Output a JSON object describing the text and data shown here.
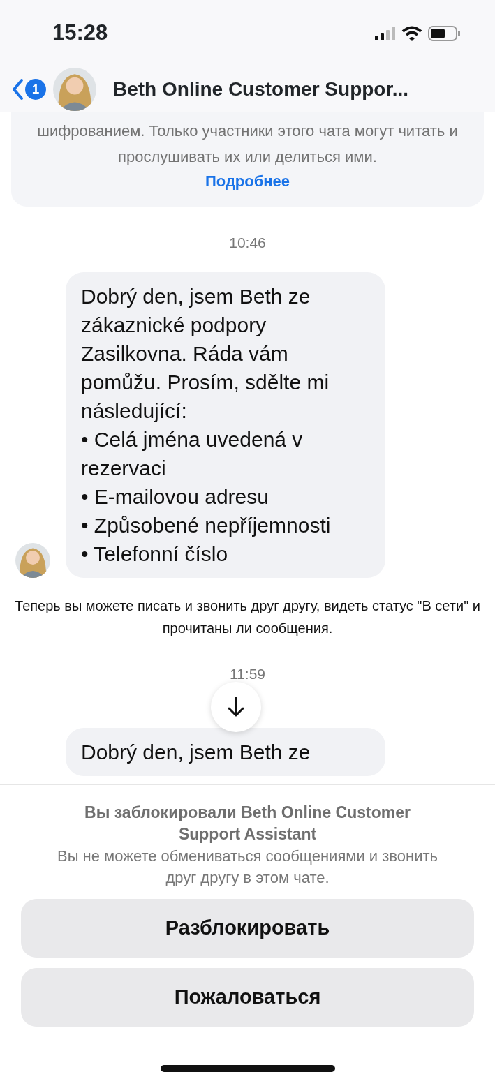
{
  "status_bar": {
    "time": "15:28"
  },
  "header": {
    "unread_badge": "1",
    "title": "Beth Online Customer Suppor..."
  },
  "encryption_notice": {
    "text": "шифрованием. Только участники этого чата могут читать и прослушивать их или делиться ими.",
    "link": "Подробнее"
  },
  "messages": [
    {
      "kind": "timestamp",
      "text": "10:46"
    },
    {
      "kind": "incoming",
      "show_avatar": true,
      "lines": [
        "Dobrý den, jsem Beth ze zákaznické podpory Zasilkovna. Ráda vám pomůžu. Prosím, sdělte mi následující:",
        "• Celá jména uvedená v rezervaci",
        "• E-mailovou adresu",
        "• Způsobené nepříjemnosti",
        "• Telefonní číslo"
      ]
    },
    {
      "kind": "system",
      "text": "Теперь вы можете писать и звонить друг другу, видеть статус \"В сети\" и прочитаны ли сообщения."
    },
    {
      "kind": "timestamp",
      "text": "11:59"
    },
    {
      "kind": "incoming",
      "show_avatar": false,
      "lines": [
        "Dobrý den, jsem Beth ze"
      ]
    }
  ],
  "blocked_panel": {
    "title": "Вы заблокировали Beth Online Customer Support Assistant",
    "text": "Вы не можете обмениваться сообщениями и звонить друг другу в этом чате.",
    "buttons": [
      "Разблокировать",
      "Пожаловаться"
    ]
  }
}
